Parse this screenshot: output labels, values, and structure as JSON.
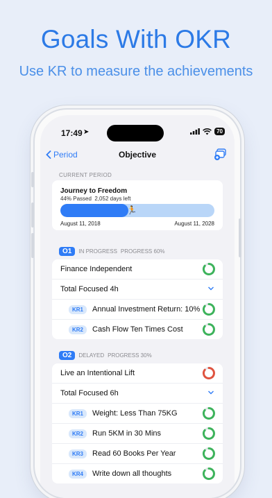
{
  "headline": "Goals With OKR",
  "subheadline": "Use KR to measure the achievements",
  "status_bar": {
    "time": "17:49",
    "battery": "70"
  },
  "nav": {
    "back_label": "Period",
    "title": "Objective"
  },
  "current_period": {
    "section_label": "CURRENT PERIOD",
    "title": "Journey to Freedom",
    "passed": "44% Passed",
    "days_left": "2,052 days left",
    "progress": 0.44,
    "start_date": "August 11, 2018",
    "end_date": "August 11, 2028"
  },
  "objectives": [
    {
      "badge": "O1",
      "status": "IN PROGRESS",
      "progress_label": "PROGRESS 60%",
      "title": "Finance Independent",
      "title_ring_color": "#3db35b",
      "focused": "Total Focused  4h",
      "krs": [
        {
          "badge": "KR1",
          "title": "Annual Investment Return: 10%",
          "ring_color": "#3db35b"
        },
        {
          "badge": "KR2",
          "title": "Cash Flow Ten Times Cost",
          "ring_color": "#3db35b"
        }
      ]
    },
    {
      "badge": "O2",
      "status": "DELAYED",
      "progress_label": "PROGRESS 30%",
      "title": "Live an Intentional Lift",
      "title_ring_color": "#e0533f",
      "focused": "Total Focused  6h",
      "krs": [
        {
          "badge": "KR1",
          "title": "Weight: Less Than 75KG",
          "ring_color": "#3db35b"
        },
        {
          "badge": "KR2",
          "title": "Run 5KM in 30 Mins",
          "ring_color": "#3db35b"
        },
        {
          "badge": "KR3",
          "title": "Read 60 Books Per Year",
          "ring_color": "#3db35b"
        },
        {
          "badge": "KR4",
          "title": "Write down all thoughts",
          "ring_color": "#3db35b"
        }
      ]
    }
  ],
  "colors": {
    "accent": "#2f7cf6",
    "success": "#3db35b",
    "danger": "#e0533f"
  }
}
